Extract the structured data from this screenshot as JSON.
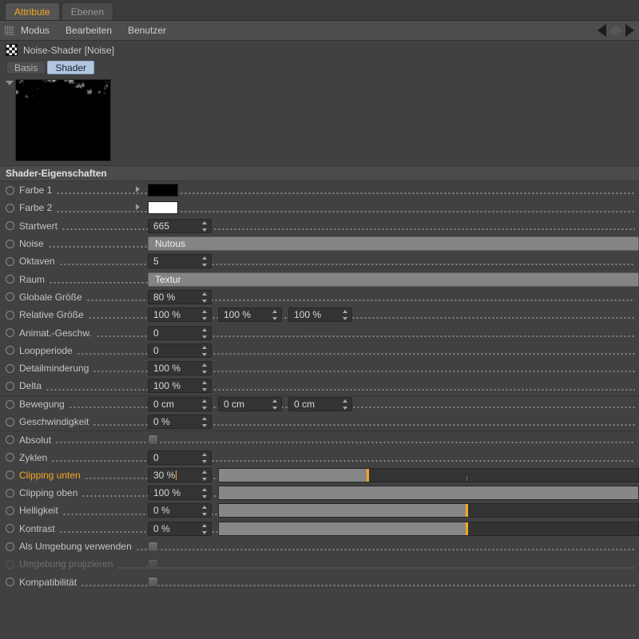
{
  "window": {
    "tabs": [
      {
        "label": "Attribute",
        "active": true
      },
      {
        "label": "Ebenen",
        "active": false
      }
    ],
    "menu": [
      "Modus",
      "Bearbeiten",
      "Benutzer"
    ],
    "grip_icon": "grip-dots-icon",
    "nav_back_icon": "nav-back-arrow-icon",
    "nav_forward_icon": "nav-forward-arrow-icon"
  },
  "object": {
    "icon": "checkerboard-shader-icon",
    "title": "Noise-Shader [Noise]",
    "subtabs": [
      {
        "label": "Basis",
        "active": false
      },
      {
        "label": "Shader",
        "active": true
      }
    ]
  },
  "preview": {
    "disclosure_icon": "triangle-down-icon",
    "name": "noise-preview-thumbnail"
  },
  "section": {
    "title": "Shader-Eigenschaften"
  },
  "colors": {
    "accent": "#f5a623",
    "panel_bg": "#414141",
    "field_bg": "#333333",
    "slider_fill": "#878787",
    "tab_active_bg": "#b3c6e0",
    "farbe1": "#000000",
    "farbe2": "#ffffff"
  },
  "params": [
    {
      "id": "farbe1",
      "label": "Farbe 1",
      "type": "color",
      "value": "#000000",
      "highlight": false,
      "disabled": false,
      "sep": false
    },
    {
      "id": "farbe2",
      "label": "Farbe 2",
      "type": "color",
      "value": "#ffffff",
      "highlight": false,
      "disabled": false,
      "sep": false
    },
    {
      "id": "startwert",
      "label": "Startwert",
      "type": "number",
      "value": "665",
      "highlight": false,
      "disabled": false,
      "sep": false
    },
    {
      "id": "noise",
      "label": "Noise",
      "type": "combo",
      "value": "Nutous",
      "highlight": false,
      "disabled": false,
      "sep": false
    },
    {
      "id": "oktaven",
      "label": "Oktaven",
      "type": "number",
      "value": "5",
      "highlight": false,
      "disabled": false,
      "sep": false
    },
    {
      "id": "raum",
      "label": "Raum",
      "type": "combo",
      "value": "Textur",
      "highlight": false,
      "disabled": false,
      "sep": false
    },
    {
      "id": "globale_groesse",
      "label": "Globale Größe",
      "type": "number",
      "value": "80 %",
      "highlight": false,
      "disabled": false,
      "sep": false
    },
    {
      "id": "relative_groesse",
      "label": "Relative Größe",
      "type": "number3",
      "values": [
        "100 %",
        "100 %",
        "100 %"
      ],
      "highlight": false,
      "disabled": false,
      "sep": false
    },
    {
      "id": "animat_geschw",
      "label": "Animat.-Geschw.",
      "type": "number",
      "value": "0",
      "highlight": false,
      "disabled": false,
      "sep": false
    },
    {
      "id": "loopperiode",
      "label": "Loopperiode",
      "type": "number",
      "value": "0",
      "highlight": false,
      "disabled": false,
      "sep": false
    },
    {
      "id": "detailminderung",
      "label": "Detailminderung",
      "type": "number",
      "value": "100 %",
      "highlight": false,
      "disabled": false,
      "sep": false
    },
    {
      "id": "delta",
      "label": "Delta",
      "type": "number",
      "value": "100 %",
      "highlight": false,
      "disabled": false,
      "sep": false
    },
    {
      "id": "bewegung",
      "label": "Bewegung",
      "type": "number3",
      "values": [
        "0 cm",
        "0 cm",
        "0 cm"
      ],
      "highlight": false,
      "disabled": false,
      "sep": true
    },
    {
      "id": "geschwindigkeit",
      "label": "Geschwindigkeit",
      "type": "number",
      "value": "0 %",
      "highlight": false,
      "disabled": false,
      "sep": false
    },
    {
      "id": "absolut",
      "label": "Absolut",
      "type": "checkbox",
      "checked": false,
      "highlight": false,
      "disabled": false,
      "sep": true
    },
    {
      "id": "zyklen",
      "label": "Zyklen",
      "type": "number",
      "value": "0",
      "highlight": false,
      "disabled": false,
      "sep": false
    },
    {
      "id": "clipping_unten",
      "label": "Clipping unten",
      "type": "slider",
      "value": "30 %",
      "fill_pct": 35.5,
      "mark_pct": 35.5,
      "tick_pct": 59,
      "caret": true,
      "highlight": true,
      "disabled": false,
      "sep": false
    },
    {
      "id": "clipping_oben",
      "label": "Clipping oben",
      "type": "slider",
      "value": "100 %",
      "fill_pct": 100,
      "mark_pct": -1,
      "tick_pct": 59,
      "caret": false,
      "highlight": false,
      "disabled": false,
      "sep": false
    },
    {
      "id": "helligkeit",
      "label": "Helligkeit",
      "type": "slider",
      "value": "0 %",
      "fill_pct": 59,
      "mark_pct": 59,
      "tick_pct": -1,
      "caret": false,
      "highlight": false,
      "disabled": false,
      "sep": false
    },
    {
      "id": "kontrast",
      "label": "Kontrast",
      "type": "slider",
      "value": "0 %",
      "fill_pct": 59,
      "mark_pct": 59,
      "tick_pct": -1,
      "caret": false,
      "highlight": false,
      "disabled": false,
      "sep": false
    },
    {
      "id": "als_umgebung_verwenden",
      "label": "Als Umgebung verwenden",
      "type": "checkbox",
      "checked": false,
      "highlight": false,
      "disabled": false,
      "sep": false
    },
    {
      "id": "umgebung_projizieren",
      "label": "Umgebung projizieren",
      "type": "checkbox",
      "checked": false,
      "highlight": false,
      "disabled": true,
      "sep": false
    },
    {
      "id": "kompatibilitaet",
      "label": "Kompatibilität",
      "type": "checkbox",
      "checked": false,
      "highlight": false,
      "disabled": false,
      "sep": false
    }
  ]
}
